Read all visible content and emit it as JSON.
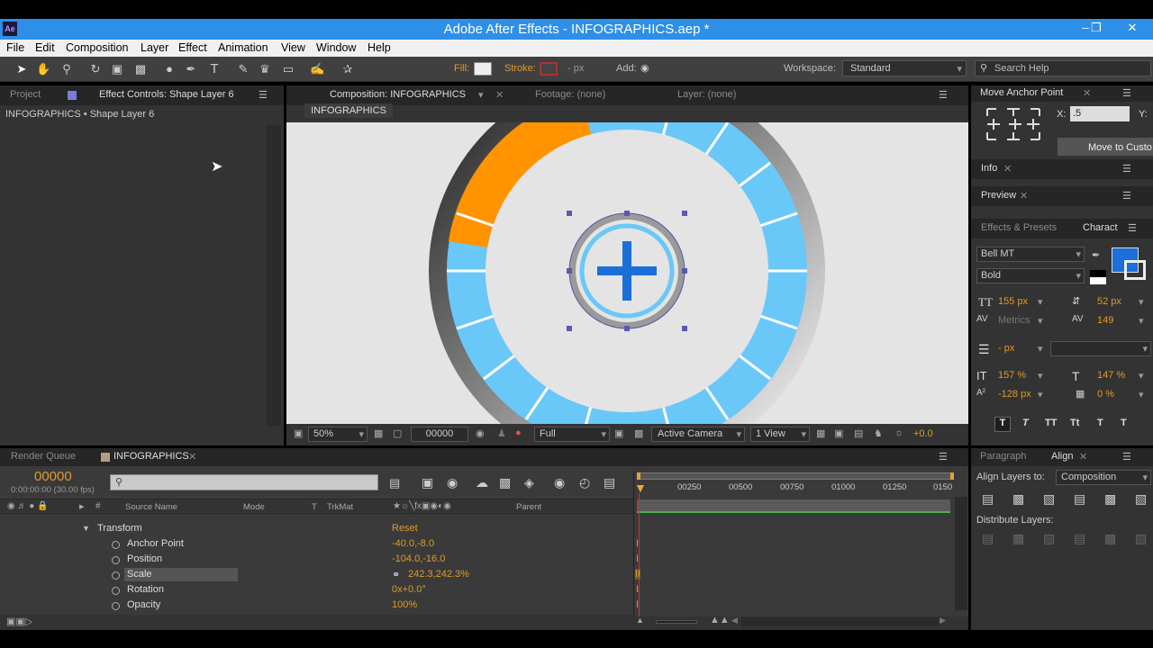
{
  "window": {
    "title": "Adobe After Effects - INFOGRAPHICS.aep *",
    "app_icon": "Ae"
  },
  "menu": [
    "File",
    "Edit",
    "Composition",
    "Layer",
    "Effect",
    "Animation",
    "View",
    "Window",
    "Help"
  ],
  "toolbar": {
    "fill_label": "Fill:",
    "stroke_label": "Stroke:",
    "stroke_width": "- px",
    "add_label": "Add:",
    "workspace_label": "Workspace:",
    "workspace_value": "Standard",
    "search_placeholder": "Search Help"
  },
  "left_panel": {
    "tab_project": "Project",
    "tab_effect_controls": "Effect Controls: Shape Layer 6",
    "breadcrumb": "INFOGRAPHICS • Shape Layer 6"
  },
  "comp_panel": {
    "tab_composition": "Composition: INFOGRAPHICS",
    "tab_footage": "Footage: (none)",
    "tab_layer": "Layer: (none)",
    "comp_button": "INFOGRAPHICS",
    "zoom": "50%",
    "timecode": "00000",
    "resolution": "Full",
    "camera": "Active Camera",
    "view": "1 View",
    "exposure": "+0.0"
  },
  "right_panel": {
    "move_anchor": "Move Anchor Point",
    "x_label": "X:",
    "x_value": ".5",
    "y_label": "Y:",
    "move_custom": "Move to Custo",
    "info": "Info",
    "preview": "Preview",
    "effects_presets": "Effects & Presets",
    "character": "Charact",
    "font": "Bell MT",
    "style": "Bold",
    "font_size": "155 px",
    "leading": "52 px",
    "kerning": "Metrics",
    "tracking": "149",
    "stroke_px": "- px",
    "vscale": "157 %",
    "hscale": "147 %",
    "baseline": "-128 px",
    "tsume": "0 %",
    "type_buttons": [
      "T",
      "T",
      "TT",
      "Tt",
      "T",
      "T"
    ],
    "fill_color": "#1a6fd8"
  },
  "timeline": {
    "tab_render": "Render Queue",
    "tab_comp": "INFOGRAPHICS",
    "timecode": "00000",
    "fps": "0:00:00:00 (30.00 fps)",
    "col_source": "Source Name",
    "col_mode": "Mode",
    "col_t": "T",
    "col_trkmat": "TrkMat",
    "col_parent": "Parent",
    "ruler": [
      "00250",
      "00500",
      "00750",
      "01000",
      "01250",
      "0150"
    ],
    "group": "Transform",
    "reset": "Reset",
    "props": [
      {
        "name": "Anchor Point",
        "value": "-40.0,-8.0"
      },
      {
        "name": "Position",
        "value": "-104.0,-16.0"
      },
      {
        "name": "Scale",
        "value": "242.3,242.3%"
      },
      {
        "name": "Rotation",
        "value": "0x+0.0°"
      },
      {
        "name": "Opacity",
        "value": "100%"
      }
    ]
  },
  "align_panel": {
    "tab_paragraph": "Paragraph",
    "tab_align": "Align",
    "align_to_label": "Align Layers to:",
    "align_to_value": "Composition",
    "distribute": "Distribute Layers:"
  },
  "colors": {
    "accent": "#ff9400",
    "segment": "#6ac8f8",
    "plus": "#1a6fd8"
  }
}
